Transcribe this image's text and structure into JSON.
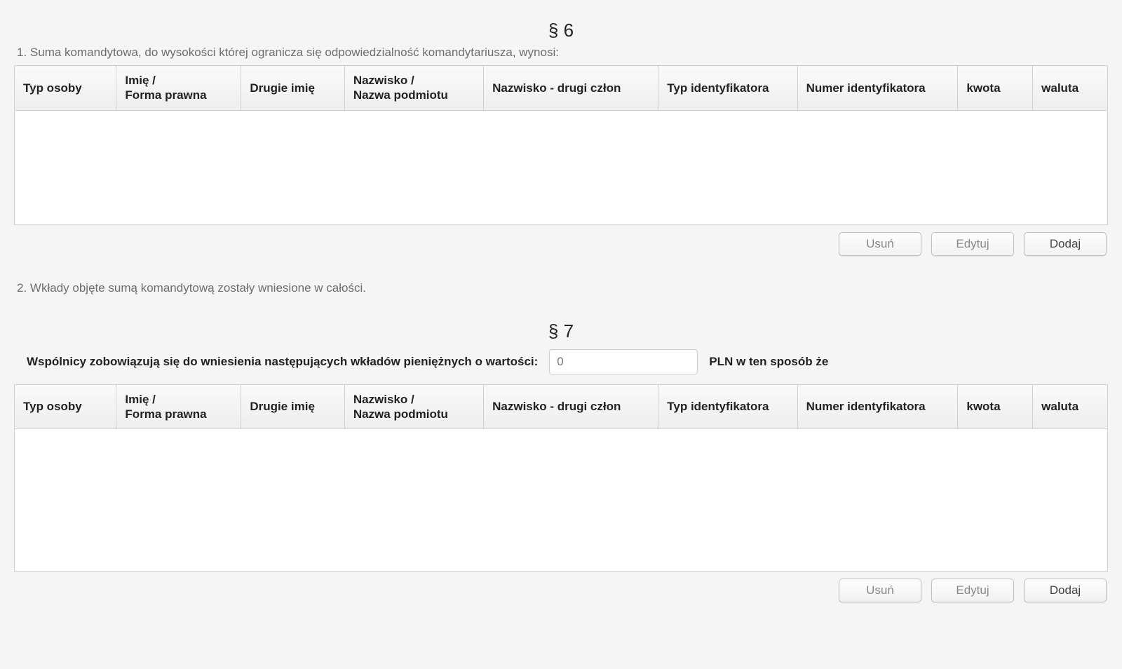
{
  "section6": {
    "title": "§ 6",
    "item1_num": "1.",
    "item1_text": "Suma komandytowa, do wysokości której ogranicza się odpowiedzialność komandytariusza, wynosi:",
    "table_headers": {
      "typ_osoby": "Typ osoby",
      "imie_forma": "Imię /\nForma prawna",
      "drugie_imie": "Drugie imię",
      "nazwisko_nazwa": "Nazwisko /\nNazwa podmiotu",
      "nazwisko_dc": "Nazwisko - drugi człon",
      "typ_id": "Typ identyfikatora",
      "numer_id": "Numer identyfikatora",
      "kwota": "kwota",
      "waluta": "waluta"
    },
    "item2_num": "2.",
    "item2_text": "Wkłady objęte sumą komandytową zostały wniesione w całości."
  },
  "section7": {
    "title": "§ 7",
    "intro_label": "Wspólnicy zobowiązują się do wniesienia następujących wkładów pieniężnych o wartości:",
    "amount_placeholder": "0",
    "intro_suffix": "PLN w ten sposób że",
    "table_headers": {
      "typ_osoby": "Typ osoby",
      "imie_forma": "Imię /\nForma prawna",
      "drugie_imie": "Drugie imię",
      "nazwisko_nazwa": "Nazwisko /\nNazwa podmiotu",
      "nazwisko_dc": "Nazwisko - drugi człon",
      "typ_id": "Typ identyfikatora",
      "numer_id": "Numer identyfikatora",
      "kwota": "kwota",
      "waluta": "waluta"
    }
  },
  "buttons": {
    "usun": "Usuń",
    "edytuj": "Edytuj",
    "dodaj": "Dodaj"
  }
}
